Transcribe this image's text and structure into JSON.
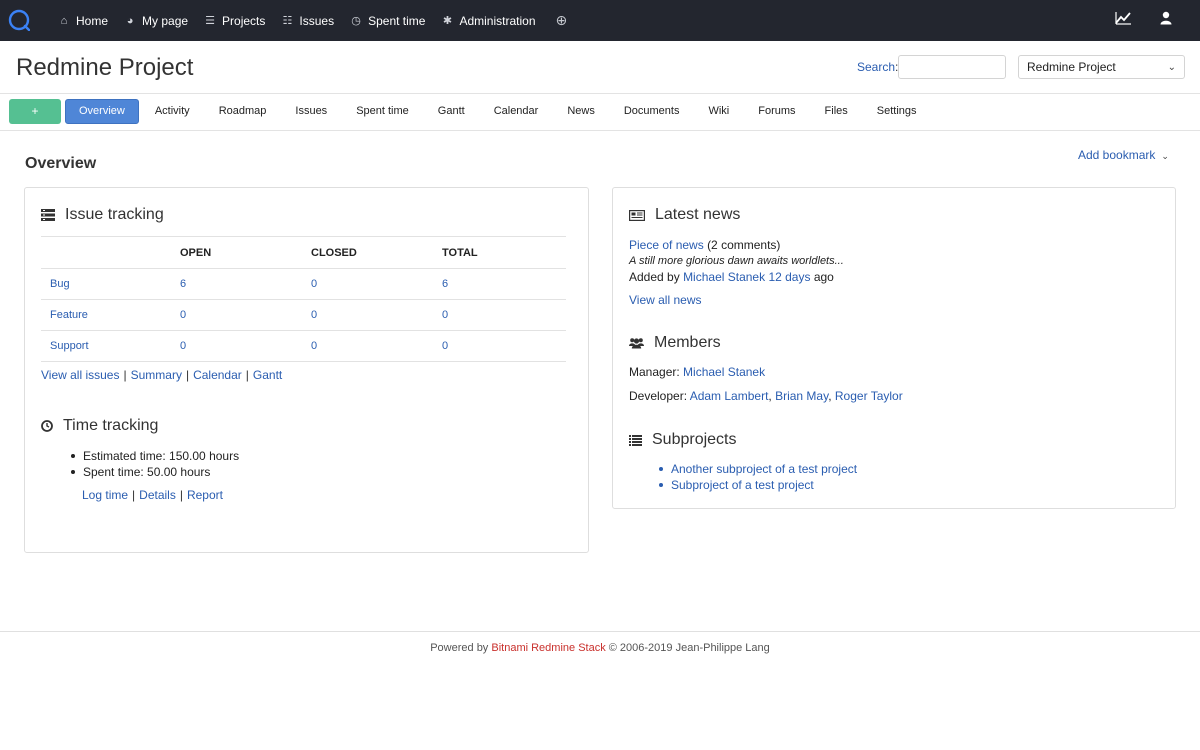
{
  "topnav": {
    "items": [
      {
        "label": "Home",
        "icon": "home-icon"
      },
      {
        "label": "My page",
        "icon": "dashboard-icon"
      },
      {
        "label": "Projects",
        "icon": "list-icon"
      },
      {
        "label": "Issues",
        "icon": "issues-icon"
      },
      {
        "label": "Spent time",
        "icon": "clock-icon"
      },
      {
        "label": "Administration",
        "icon": "gear-icon"
      }
    ]
  },
  "header": {
    "project_title": "Redmine Project",
    "search_label": "Search",
    "search_colon": ":",
    "search_value": "",
    "project_select": "Redmine Project"
  },
  "tabs": {
    "plus_label": "+",
    "items": [
      "Overview",
      "Activity",
      "Roadmap",
      "Issues",
      "Spent time",
      "Gantt",
      "Calendar",
      "News",
      "Documents",
      "Wiki",
      "Forums",
      "Files",
      "Settings"
    ],
    "active": "Overview"
  },
  "content": {
    "title": "Overview",
    "add_bookmark": "Add bookmark"
  },
  "issue_tracking": {
    "heading": "Issue tracking",
    "columns": [
      "",
      "OPEN",
      "CLOSED",
      "TOTAL"
    ],
    "rows": [
      {
        "tracker": "Bug",
        "open": "6",
        "closed": "0",
        "total": "6"
      },
      {
        "tracker": "Feature",
        "open": "0",
        "closed": "0",
        "total": "0"
      },
      {
        "tracker": "Support",
        "open": "0",
        "closed": "0",
        "total": "0"
      }
    ],
    "links": [
      "View all issues",
      "Summary",
      "Calendar",
      "Gantt"
    ],
    "separator": "|"
  },
  "time_tracking": {
    "heading": "Time tracking",
    "estimated": "Estimated time: 150.00 hours",
    "spent": "Spent time: 50.00 hours",
    "links": [
      "Log time",
      "Details",
      "Report"
    ]
  },
  "latest_news": {
    "heading": "Latest news",
    "title": "Piece of news",
    "comments": "(2 comments)",
    "description": "A still more glorious dawn awaits worldlets...",
    "added_by_prefix": "Added by",
    "author": "Michael Stanek",
    "age": "12 days",
    "age_suffix": "ago",
    "view_all": "View all news"
  },
  "members": {
    "heading": "Members",
    "manager_label": "Manager:",
    "manager": "Michael Stanek",
    "developer_label": "Developer:",
    "developers": [
      "Adam Lambert",
      "Brian May",
      "Roger Taylor"
    ]
  },
  "subprojects": {
    "heading": "Subprojects",
    "items": [
      "Another subproject of a test project",
      "Subproject of a test project"
    ]
  },
  "footer": {
    "prefix": "Powered by",
    "brand": "Bitnami Redmine Stack",
    "suffix": "© 2006-2019 Jean-Philippe Lang"
  },
  "colors": {
    "topbar": "#23262f",
    "link": "#2a5db0",
    "active_tab": "#4f86d7",
    "plus_button": "#55c092",
    "brand": "#c9302c"
  }
}
